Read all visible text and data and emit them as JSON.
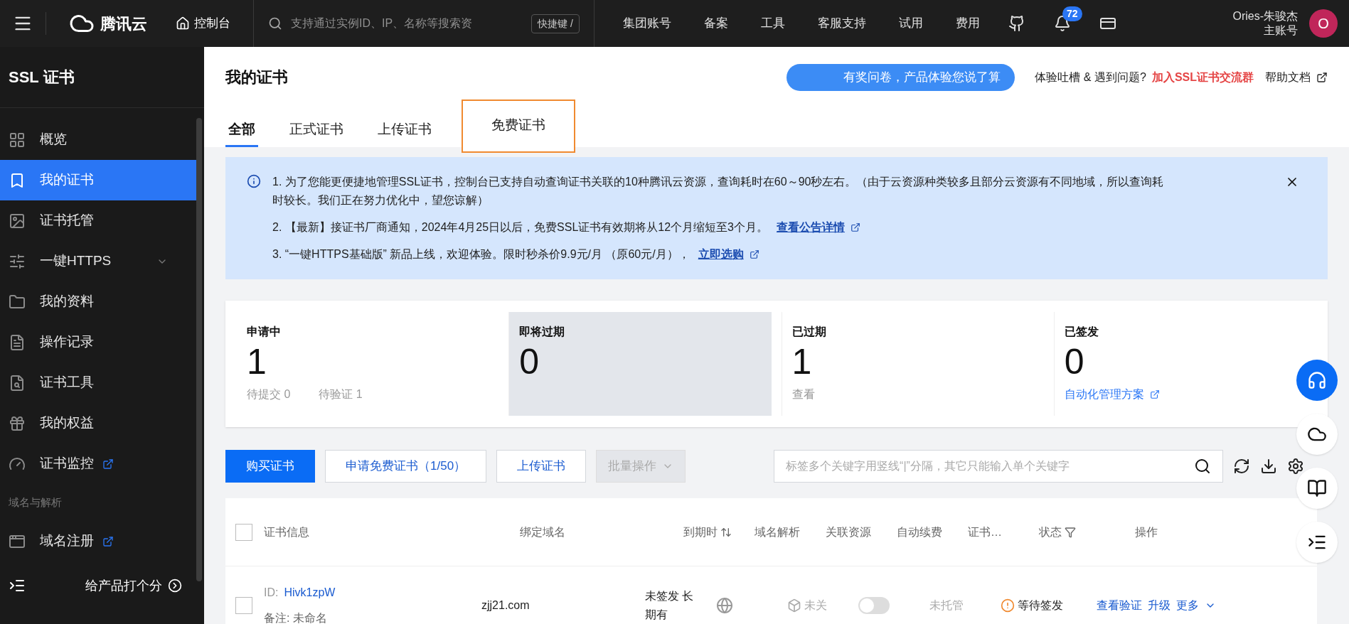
{
  "topbar": {
    "brand": "腾讯云",
    "console": "控制台",
    "search_placeholder": "支持通过实例ID、IP、名称等搜索资",
    "shortcut": "快捷键 /",
    "links": [
      "集团账号",
      "备案",
      "工具",
      "客服支持",
      "试用",
      "费用"
    ],
    "notifications": "72",
    "user": {
      "name": "Ories-朱骏杰",
      "role": "主账号",
      "avatar": "O"
    }
  },
  "sidebar": {
    "title": "SSL 证书",
    "items": [
      {
        "label": "概览",
        "selected": false,
        "external": false,
        "expandable": false
      },
      {
        "label": "我的证书",
        "selected": true,
        "external": false,
        "expandable": false
      },
      {
        "label": "证书托管",
        "selected": false,
        "external": false,
        "expandable": false
      },
      {
        "label": "一键HTTPS",
        "selected": false,
        "external": false,
        "expandable": true
      },
      {
        "label": "我的资料",
        "selected": false,
        "external": false,
        "expandable": false
      },
      {
        "label": "操作记录",
        "selected": false,
        "external": false,
        "expandable": false
      },
      {
        "label": "证书工具",
        "selected": false,
        "external": false,
        "expandable": false
      },
      {
        "label": "我的权益",
        "selected": false,
        "external": false,
        "expandable": false
      },
      {
        "label": "证书监控",
        "selected": false,
        "external": true,
        "expandable": false
      }
    ],
    "section": "域名与解析",
    "section_items": [
      {
        "label": "域名注册",
        "selected": false,
        "external": true,
        "expandable": false
      }
    ],
    "footer": "给产品打个分"
  },
  "page": {
    "title": "我的证书",
    "survey": "有奖问卷，产品体验您说了算",
    "feedback": "体验吐槽 & 遇到问题?",
    "group_link": "加入SSL证书交流群",
    "help": "帮助文档",
    "tabs": [
      {
        "label": "全部",
        "selected": true,
        "highlighted": false
      },
      {
        "label": "正式证书",
        "selected": false,
        "highlighted": false
      },
      {
        "label": "上传证书",
        "selected": false,
        "highlighted": false
      },
      {
        "label": "免费证书",
        "selected": false,
        "highlighted": true
      }
    ]
  },
  "notice": [
    {
      "text": "1. 为了您能更便捷地管理SSL证书，控制台已支持自动查询证书关联的10种腾讯云资源，查询耗时在60～90秒左右。（由于云资源种类较多且部分云资源有不同地域，所以查询耗时较长。我们正在努力优化中，望您谅解）"
    },
    {
      "text": "2. 【最新】接证书厂商通知，2024年4月25日以后，免费SSL证书有效期将从12个月缩短至3个月。",
      "link": "查看公告详情"
    },
    {
      "text": "3. “一键HTTPS基础版” 新品上线，欢迎体验。限时秒杀价9.9元/月 （原60元/月），",
      "link": "立即选购"
    }
  ],
  "stats": [
    {
      "title": "申请中",
      "value": "1",
      "selected": false,
      "subs": [
        "待提交 0",
        "待验证 1"
      ]
    },
    {
      "title": "即将过期",
      "value": "0",
      "selected": true
    },
    {
      "title": "已过期",
      "value": "1",
      "selected": false,
      "subs": [
        "查看"
      ]
    },
    {
      "title": "已签发",
      "value": "0",
      "selected": false,
      "link": "自动化管理方案"
    }
  ],
  "toolbar": {
    "buttons": [
      {
        "label": "购买证书",
        "kind": "primary"
      },
      {
        "label": "申请免费证书（1/50）",
        "kind": "default"
      },
      {
        "label": "上传证书",
        "kind": "default"
      },
      {
        "label": "批量操作",
        "kind": "disabled"
      }
    ],
    "search_placeholder": "标签多个关键字用竖线“|”分隔，其它只能输入单个关键字"
  },
  "table": {
    "select_all_checked": false,
    "columns": [
      "证书信息",
      "绑定域名",
      "到期时",
      "域名解析",
      "关联资源",
      "自动续费",
      "证书…",
      "状态",
      "操作"
    ],
    "rows": [
      {
        "checked": false,
        "id_label": "ID:",
        "id": "Hivk1zpW",
        "note": "备注: 未命名",
        "domain": "zjj21.com",
        "expiry": "未签发 长期有",
        "resource": "未关",
        "auto_renew": false,
        "hosting": "未托管",
        "status": "等待签发",
        "actions": [
          "查看验证",
          "升级",
          "更多"
        ]
      }
    ]
  }
}
